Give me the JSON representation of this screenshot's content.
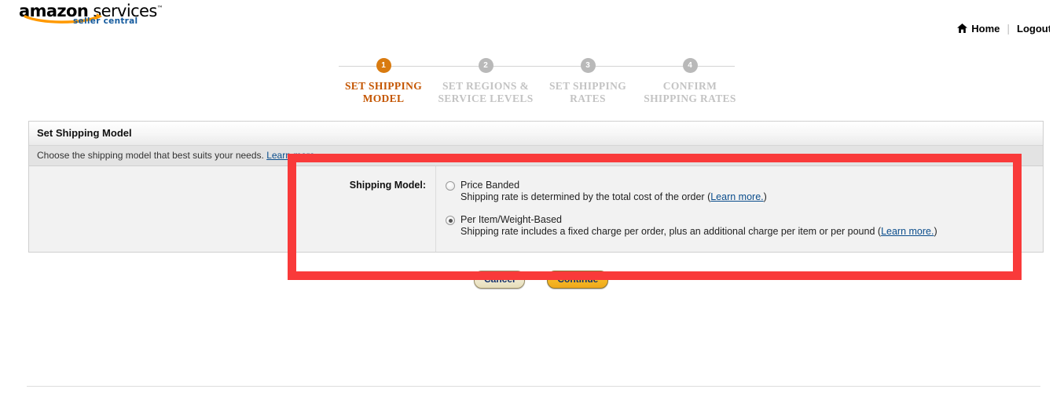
{
  "header": {
    "logo": {
      "brand": "amazon",
      "service": "services",
      "trademark": "™",
      "subtitle": "seller central"
    },
    "nav": {
      "home_label": "Home",
      "home_icon": "home-icon",
      "separator": "|",
      "logout_label": "Logout"
    }
  },
  "stepper": {
    "steps": [
      {
        "number": "1",
        "label": "SET SHIPPING MODEL",
        "state": "active"
      },
      {
        "number": "2",
        "label": "SET REGIONS & SERVICE LEVELS",
        "state": "inactive"
      },
      {
        "number": "3",
        "label": "SET SHIPPING RATES",
        "state": "inactive"
      },
      {
        "number": "4",
        "label": "CONFIRM SHIPPING RATES",
        "state": "inactive"
      }
    ]
  },
  "panel": {
    "title": "Set Shipping Model",
    "description_text": "Choose the shipping model that best suits your needs.",
    "description_link": "Learn more.",
    "field_label": "Shipping Model:",
    "options": [
      {
        "title": "Price Banded",
        "description": "Shipping rate is determined by the total cost of the order (",
        "link": "Learn more.",
        "description_end": ")",
        "selected": false
      },
      {
        "title": "Per Item/Weight-Based",
        "description": "Shipping rate includes a fixed charge per order, plus an additional charge per item or per pound (",
        "link": "Learn more.",
        "description_end": ")",
        "selected": true
      }
    ]
  },
  "actions": {
    "cancel_label": "Cancel",
    "continue_label": "Continue"
  },
  "colors": {
    "accent_orange": "#c45500",
    "step_active": "#d97b10",
    "step_inactive": "#b9b9b9",
    "link_blue": "#0b4d8c",
    "annotation_red": "#f93a3a",
    "button_continue": "#f6ba26"
  }
}
